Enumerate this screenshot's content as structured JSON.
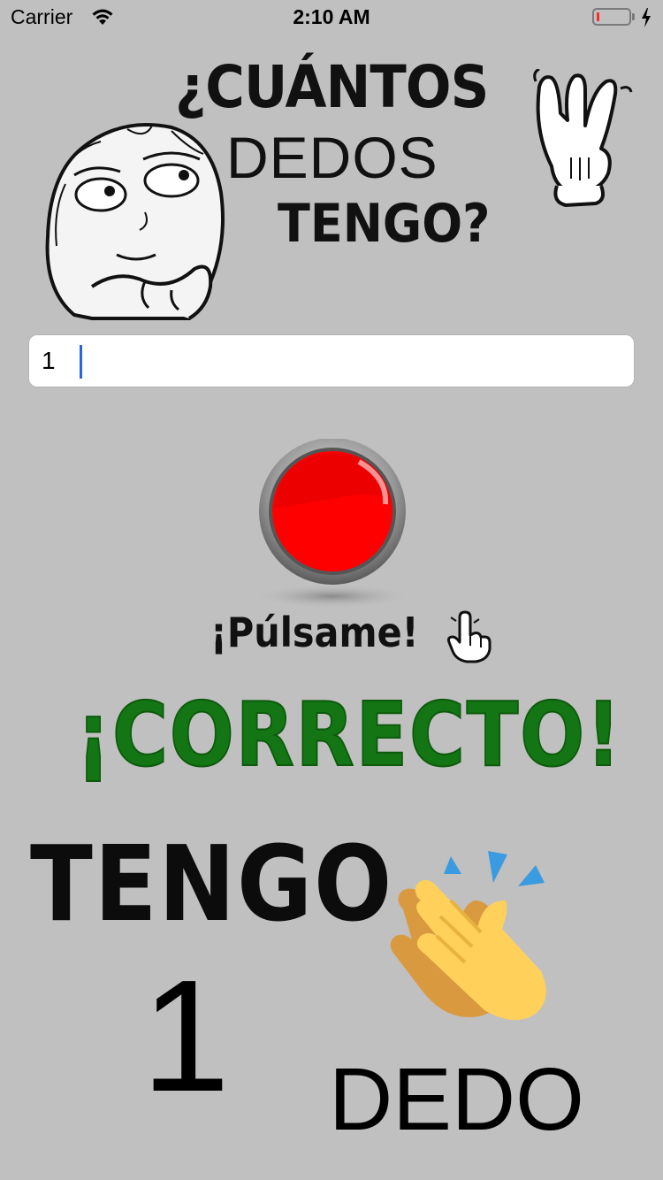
{
  "status_bar": {
    "carrier": "Carrier",
    "time": "2:10 AM",
    "battery_level": 0.1,
    "battery_color": "#ff2a2a",
    "icons": [
      "wifi-icon",
      "battery-icon",
      "charging-bolt-icon"
    ]
  },
  "title": {
    "line1": "¿CUÁNTOS",
    "line2": "DEDOS",
    "line3": "TENGO?"
  },
  "input": {
    "value": "1",
    "caret_color": "#2a63e8"
  },
  "button": {
    "label": "¡Púlsame!",
    "color": "#ff0000",
    "icon": "pointing-hand-icon"
  },
  "result": {
    "message": "¡CORRECTO!",
    "message_color": "#137513",
    "tengo": "TENGO",
    "number": "1",
    "dedo": "DEDO",
    "icon": "clapping-hands-icon"
  },
  "colors": {
    "background": "#c0c0c0"
  }
}
